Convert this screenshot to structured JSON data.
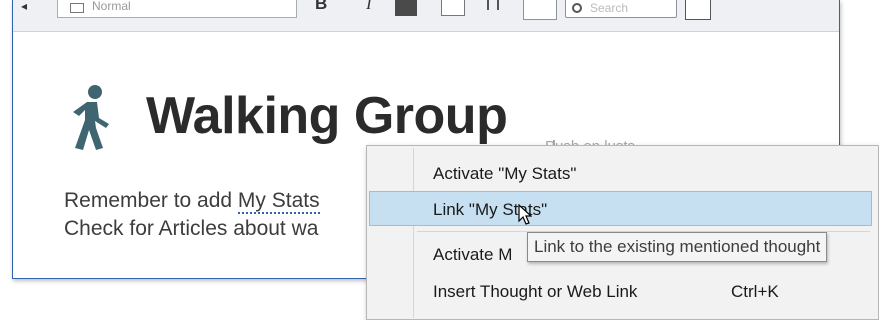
{
  "toolbar": {
    "style_dropdown": "Normal",
    "bold_label": "B",
    "italic_label": "I",
    "search_placeholder": "Search"
  },
  "note": {
    "title": "Walking Group",
    "line1_prefix": "Remember to add ",
    "line1_mention": "My Stats",
    "line2": "Check for Articles about wa",
    "ghost_text": "Push on lusts"
  },
  "context_menu": {
    "items": [
      {
        "label": "Activate \"My Stats\"",
        "shortcut": ""
      },
      {
        "label": "Link \"My Stats\"",
        "shortcut": ""
      },
      {
        "label": "Activate M",
        "shortcut": ""
      },
      {
        "label": "Insert Thought or Web Link",
        "shortcut": "Ctrl+K"
      }
    ],
    "highlighted_index": 1
  },
  "tooltip": {
    "text": "Link to the existing mentioned thought"
  },
  "colors": {
    "accent": "#2f63b0",
    "menu_highlight": "#c7e0f1",
    "walker_icon": "#3f6670",
    "title_text": "#2b2b2b"
  }
}
